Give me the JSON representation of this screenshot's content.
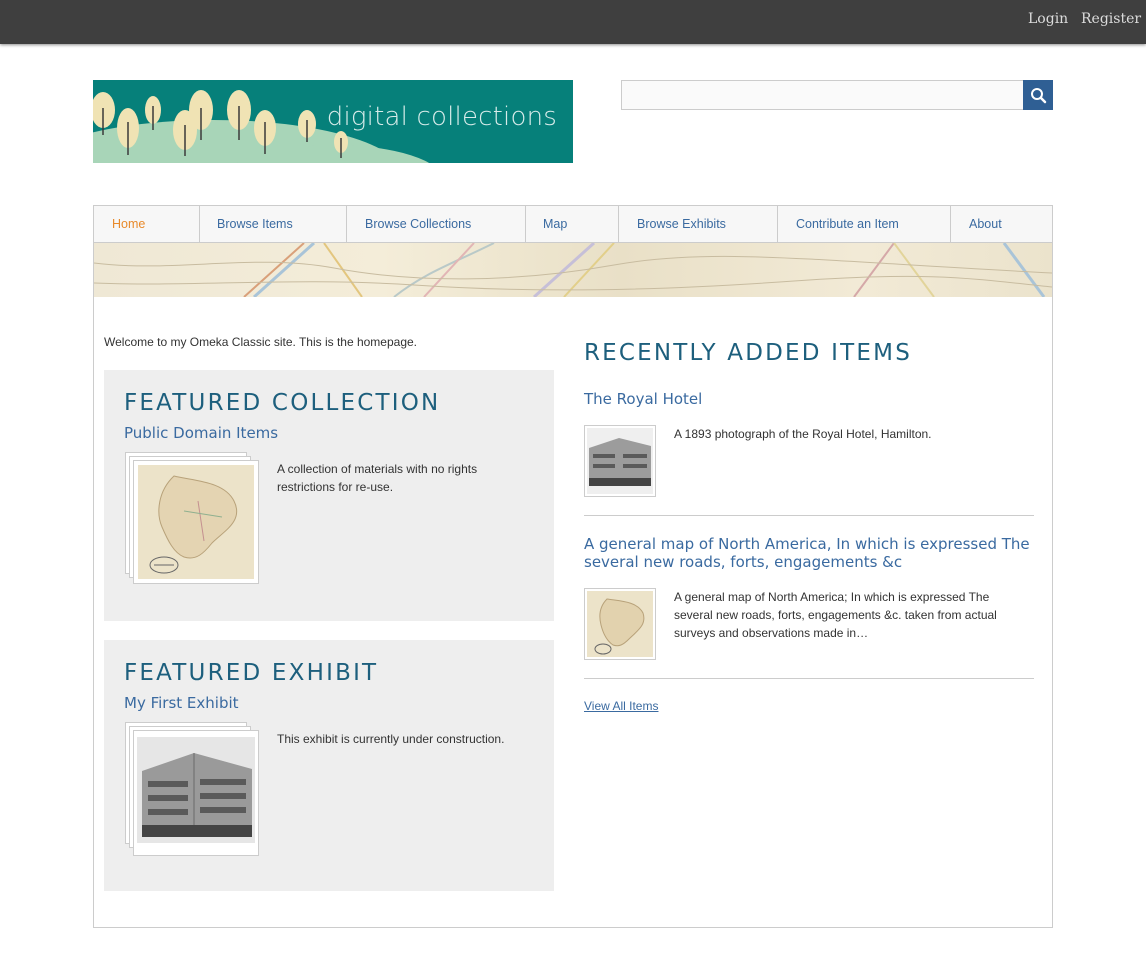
{
  "topbar": {
    "login": "Login",
    "register": "Register"
  },
  "header": {
    "site_title": "digital collections",
    "search_value": ""
  },
  "nav": [
    {
      "label": "Home",
      "active": true
    },
    {
      "label": "Browse Items"
    },
    {
      "label": "Browse Collections"
    },
    {
      "label": "Map"
    },
    {
      "label": "Browse Exhibits"
    },
    {
      "label": "Contribute an Item"
    },
    {
      "label": "About"
    }
  ],
  "main": {
    "welcome": "Welcome to my Omeka Classic site. This is the homepage.",
    "featured_collection": {
      "heading": "FEATURED COLLECTION",
      "title": "Public Domain Items",
      "description": "A collection of materials with no rights restrictions for re-use."
    },
    "featured_exhibit": {
      "heading": "FEATURED EXHIBIT",
      "title": "My First Exhibit",
      "description": "This exhibit is currently under construction."
    }
  },
  "recent": {
    "heading": "RECENTLY ADDED ITEMS",
    "items": [
      {
        "title": "The Royal Hotel",
        "description": "A 1893 photograph of the Royal Hotel, Hamilton."
      },
      {
        "title": "A general map of North America, In which is expressed The several new roads, forts, engagements &c",
        "description": "A general map of North America; In which is expressed The several new roads, forts, engagements &c. taken from actual surveys and observations made in…"
      }
    ],
    "view_all": "View All Items"
  },
  "colors": {
    "topbar": "#3f3f3f",
    "banner": "#06807a",
    "link": "#3a6aa0",
    "heading": "#1d5f7d",
    "active_nav": "#e88a2b",
    "panel": "#eeeeee"
  }
}
